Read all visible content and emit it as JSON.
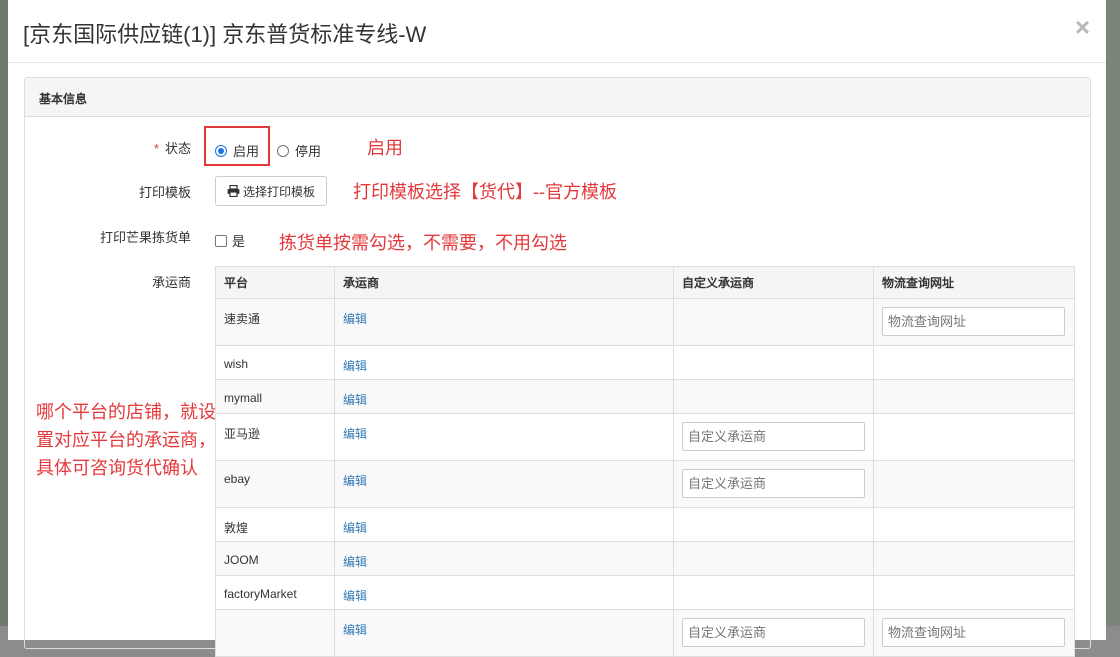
{
  "modal": {
    "title": "[京东国际供应链(1)] 京东普货标准专线-W",
    "close_glyph": "×"
  },
  "panel": {
    "heading": "基本信息"
  },
  "form": {
    "status": {
      "required_mark": "*",
      "label": "状态",
      "options": [
        "启用",
        "停用"
      ],
      "selected": "启用"
    },
    "print_template": {
      "label": "打印模板",
      "button_label": "选择打印模板"
    },
    "picking_list": {
      "label": "打印芒果拣货单",
      "checkbox_label": "是",
      "checked": false
    },
    "carrier": {
      "label": "承运商"
    }
  },
  "table": {
    "headers": [
      "平台",
      "承运商",
      "自定义承运商",
      "物流查询网址"
    ],
    "edit_label": "编辑",
    "custom_carrier_placeholder": "自定义承运商",
    "tracking_url_placeholder": "物流查询网址",
    "rows": [
      {
        "platform": "速卖通",
        "custom_input": false,
        "tracking_input": true
      },
      {
        "platform": "wish",
        "custom_input": false,
        "tracking_input": false
      },
      {
        "platform": "mymall",
        "custom_input": false,
        "tracking_input": false
      },
      {
        "platform": "亚马逊",
        "custom_input": true,
        "tracking_input": false
      },
      {
        "platform": "ebay",
        "custom_input": true,
        "tracking_input": false
      },
      {
        "platform": "敦煌",
        "custom_input": false,
        "tracking_input": false
      },
      {
        "platform": "JOOM",
        "custom_input": false,
        "tracking_input": false
      },
      {
        "platform": "factoryMarket",
        "custom_input": false,
        "tracking_input": false
      },
      {
        "platform": "",
        "custom_input": true,
        "tracking_input": true
      }
    ]
  },
  "annotations": {
    "status_note": "启用",
    "template_note": "打印模板选择【货代】--官方模板",
    "picking_note": "拣货单按需勾选，不需要，不用勾选",
    "carrier_note": "哪个平台的店铺，就设置对应平台的承运商，具体可咨询货代确认"
  },
  "colors": {
    "annotation_red": "#e4393c",
    "link_blue": "#337ab7"
  }
}
